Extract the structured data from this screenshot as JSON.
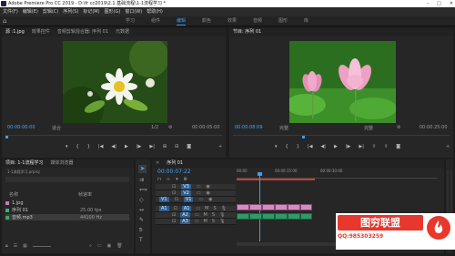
{
  "window": {
    "title": "Adobe Premiere Pro CC 2019 - D:\\fr cc2019\\2.1 基础流程\\1-1流程学习 *",
    "min": "–",
    "max": "□",
    "close": "✕"
  },
  "menu": [
    "文件(F)",
    "编辑(E)",
    "剪辑(C)",
    "序列(S)",
    "标记(M)",
    "图形(G)",
    "窗口(W)",
    "帮助(H)"
  ],
  "workspaces": [
    "学习",
    "组件",
    "编辑",
    "颜色",
    "效果",
    "音频",
    "图形",
    "库"
  ],
  "source": {
    "tabs": [
      "源 :1.jpg",
      "效果控件",
      "音频剪辑混合器: 序列 01",
      "元数据"
    ],
    "timecode": "00:00:00:00",
    "fit": "适合",
    "ratio": "1/2",
    "duration": "00:00:05:00"
  },
  "program": {
    "tab": "节目: 序列 01",
    "timecode": "00:00:08:09",
    "fit": "完整",
    "duration": "00:00:25:00"
  },
  "project": {
    "tabs": [
      "项目: 1-1流程学习",
      "媒体浏览器"
    ],
    "path": "1-1流程学习.prproj",
    "name_header": "名称",
    "fps_header": "帧速率",
    "items": [
      {
        "name": "1.jpg",
        "fps": "",
        "color": "#c27ac0"
      },
      {
        "name": "序列 01",
        "fps": "25.00 fps",
        "color": "#37b37a"
      },
      {
        "name": "音频.mp3",
        "fps": "44100 Hz",
        "color": "#3fa35f"
      }
    ]
  },
  "timeline": {
    "tab": "序列 01",
    "timecode": "00:00:07:22",
    "ruler": [
      "00:00",
      "00:00:15:00",
      "00:00:30:00"
    ],
    "tracks": [
      "V3",
      "V2",
      "V1",
      "A1",
      "A2",
      "A3"
    ],
    "src_tracks": [
      "V1",
      "A1"
    ]
  },
  "watermark": {
    "title": "图穷联盟",
    "qq": "QQ:985303259"
  },
  "icons": {
    "play": "▶",
    "step_back": "◀|",
    "step_fwd": "|▶",
    "mark_in": "{",
    "mark_out": "}",
    "wrench": "🔧",
    "camera": "📷"
  }
}
